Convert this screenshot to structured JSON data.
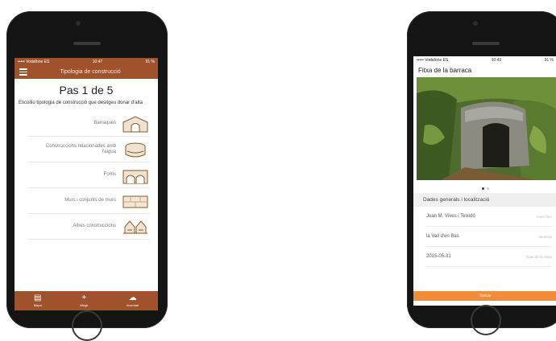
{
  "left_phone": {
    "status": {
      "carrier": "••••• Vodafone ES",
      "time": "10:47",
      "battery": "91 %"
    },
    "appbar_title": "Tipologia de construcció",
    "step_title": "Pas 1 de 5",
    "question": "Escolliu tipologia de construcció que desitgeu donar d'alta",
    "categories": [
      {
        "label": "Barraques",
        "icon": "hut-icon"
      },
      {
        "label": "Construccions relacionades amb l'aigua",
        "icon": "well-icon"
      },
      {
        "label": "Forns",
        "icon": "oven-icon"
      },
      {
        "label": "Murs i conjunts de murs",
        "icon": "wall-icon"
      },
      {
        "label": "Altres construccions",
        "icon": "other-icon"
      }
    ],
    "nav": [
      {
        "label": "Mapa",
        "icon": "map-icon"
      },
      {
        "label": "Afegir",
        "icon": "plus-icon"
      },
      {
        "label": "Inventari",
        "icon": "cloud-icon"
      }
    ]
  },
  "right_phone": {
    "status": {
      "carrier": "••••• Vodafone ES",
      "time": "10:43",
      "battery": "91 %"
    },
    "title": "Fitxa de la barraca",
    "section": "Dades generals i localització",
    "rows": [
      {
        "value": "Joan M. Vives i Teixidó",
        "key": "Autor foto"
      },
      {
        "value": "la Vall d'en Bas",
        "key": "Municipi"
      },
      {
        "value": "2015-05-31",
        "key": "Data de la visita"
      }
    ],
    "button": "Tancar"
  },
  "colors": {
    "brand": "#a0522d",
    "accent": "#f08c3a"
  }
}
